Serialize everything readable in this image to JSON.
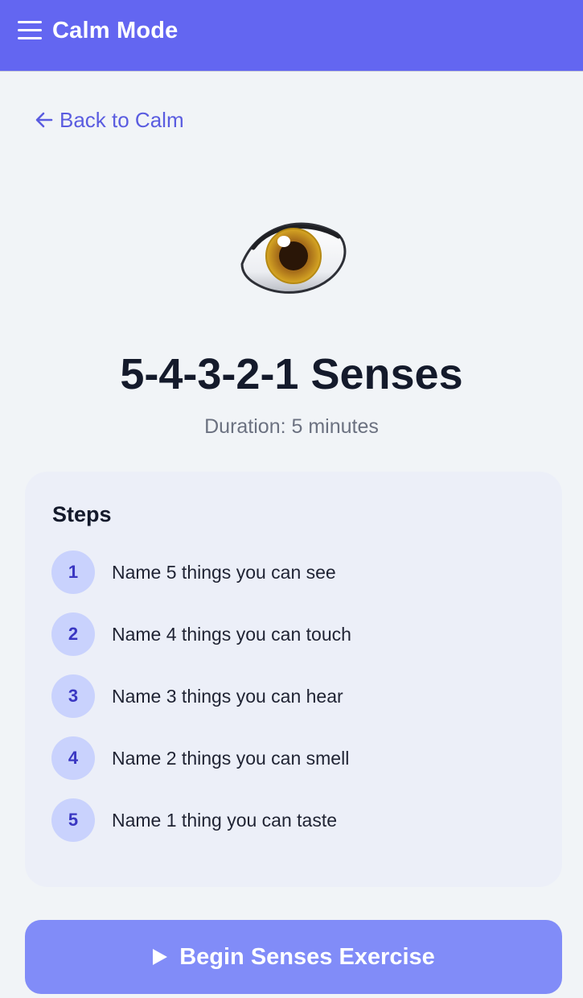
{
  "header": {
    "title": "Calm Mode",
    "menu_icon": "hamburger-menu-icon",
    "background": "#6366f1"
  },
  "nav": {
    "back_label": "Back to Calm",
    "back_icon": "arrow-left-icon",
    "color": "#5a5ce0"
  },
  "exercise": {
    "icon": "eye-icon",
    "title": "5-4-3-2-1 Senses",
    "duration": "Duration: 5 minutes"
  },
  "steps": {
    "heading": "Steps",
    "items": [
      {
        "number": "1",
        "text": "Name 5 things you can see"
      },
      {
        "number": "2",
        "text": "Name 4 things you can touch"
      },
      {
        "number": "3",
        "text": "Name 3 things you can hear"
      },
      {
        "number": "4",
        "text": "Name 2 things you can smell"
      },
      {
        "number": "5",
        "text": "Name 1 thing you can taste"
      }
    ]
  },
  "action": {
    "label": "Begin Senses Exercise",
    "icon": "play-icon",
    "background": "#818cf8"
  }
}
